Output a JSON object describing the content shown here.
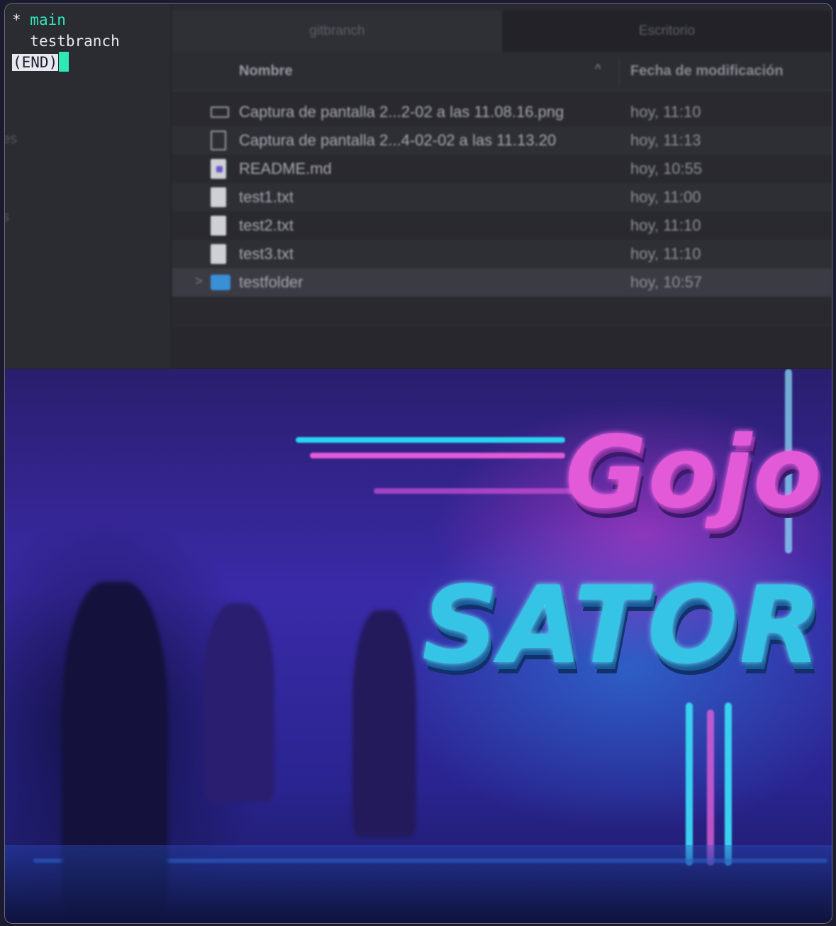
{
  "terminal": {
    "lines": [
      {
        "marker": "* ",
        "branch": "main",
        "current": true
      },
      {
        "marker": "  ",
        "branch": "testbranch",
        "current": false
      }
    ],
    "pager_end": "(END)"
  },
  "finder": {
    "sidebar_ghost_text": [
      "es",
      "s"
    ],
    "tabs": [
      {
        "label": "gitbranch",
        "active": true
      },
      {
        "label": "Escritorio",
        "active": false
      }
    ],
    "columns": {
      "name": "Nombre",
      "sort_indicator": "^",
      "date": "Fecha de modificación"
    },
    "files": [
      {
        "name": "Captura de pantalla 2...2-02 a las 11.08.16.png",
        "date": "hoy, 11:10",
        "icon": "image-file-icon"
      },
      {
        "name": "Captura de pantalla 2...4-02-02 a las 11.13.20",
        "date": "hoy, 11:13",
        "icon": "blank-file-icon"
      },
      {
        "name": "README.md",
        "date": "hoy, 10:55",
        "icon": "markdown-file-icon"
      },
      {
        "name": "test1.txt",
        "date": "hoy, 11:00",
        "icon": "text-file-icon"
      },
      {
        "name": "test2.txt",
        "date": "hoy, 11:10",
        "icon": "text-file-icon"
      },
      {
        "name": "test3.txt",
        "date": "hoy, 11:10",
        "icon": "text-file-icon"
      },
      {
        "name": "testfolder",
        "date": "hoy, 10:57",
        "icon": "folder-icon",
        "selected": true
      }
    ]
  },
  "wallpaper": {
    "sign_line_1": "Gojo",
    "sign_line_2": "SATOR"
  },
  "colors": {
    "terminal_accent": "#2ee8b6",
    "neon_pink": "#e25ad8",
    "neon_cyan": "#35c4e6"
  }
}
